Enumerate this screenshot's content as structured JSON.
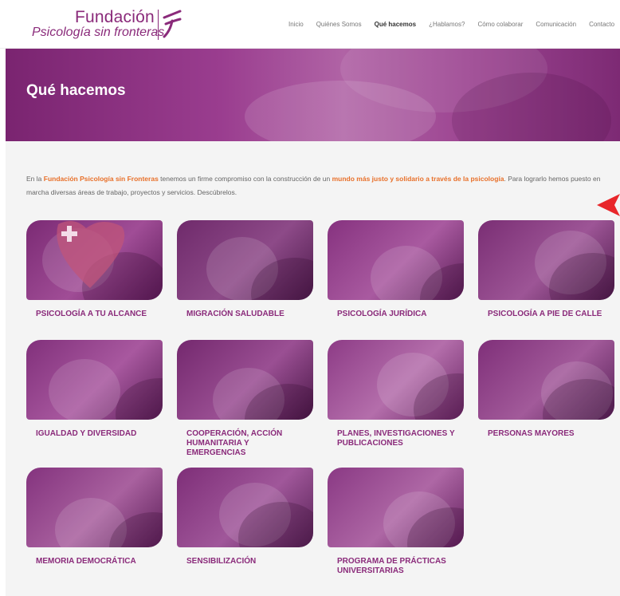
{
  "logo": {
    "line1": "Fundación",
    "line2": "Psicología sin fronteras"
  },
  "nav": [
    "Inicio",
    "Quiénes Somos",
    "Qué hacemos",
    "¿Hablamos?",
    "Cómo colaborar",
    "Comunicación",
    "Contacto"
  ],
  "nav_active": "Qué hacemos",
  "hero": {
    "title": "Qué hacemos"
  },
  "intro": {
    "p1": "En la ",
    "h1": "Fundación Psicología sin Fronteras",
    "p2": " tenemos un firme compromiso con la construcción de un ",
    "h2": "mundo más justo y solidario a través de la psicología",
    "p3": ". Para lograrlo hemos puesto en marcha diversas áreas de trabajo, proyectos y servicios. Descúbrelos."
  },
  "cards": [
    {
      "title": "PSICOLOGÍA A TU ALCANCE"
    },
    {
      "title": "MIGRACIÓN SALUDABLE"
    },
    {
      "title": "PSICOLOGÍA JURÍDICA"
    },
    {
      "title": "PSICOLOGÍA A PIE DE CALLE"
    },
    {
      "title": "IGUALDAD Y DIVERSIDAD"
    },
    {
      "title": "COOPERACIÓN, ACCIÓN HUMANITARIA Y EMERGENCIAS"
    },
    {
      "title": "PLANES, INVESTIGACIONES Y PUBLICACIONES"
    },
    {
      "title": "PERSONAS MAYORES"
    },
    {
      "title": "MEMORIA DEMOCRÁTICA"
    },
    {
      "title": "SENSIBILIZACIÓN"
    },
    {
      "title": "PROGRAMA DE PRÁCTICAS UNIVERSITARIAS"
    }
  ],
  "colors": {
    "brand": "#8a2a7a",
    "highlight": "#e8702a",
    "arrow": "#e8262a"
  }
}
